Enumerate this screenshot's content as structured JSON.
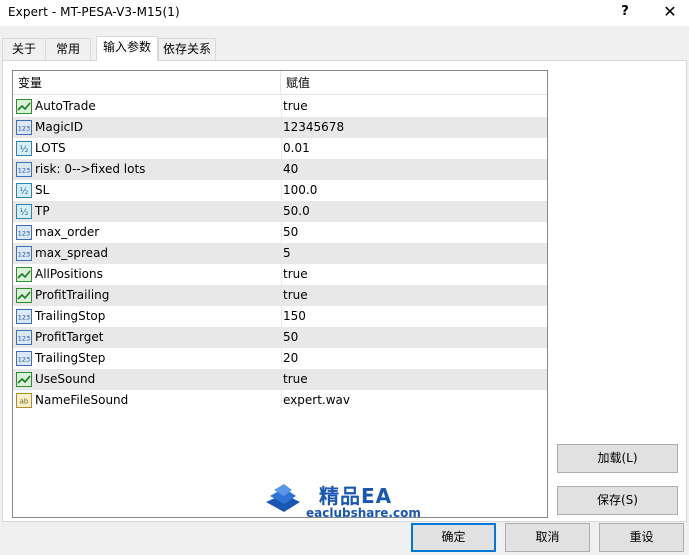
{
  "window": {
    "title": "Expert - MT-PESA-V3-M15(1)",
    "help_label": "?",
    "close_label": "✕"
  },
  "tabs": [
    {
      "label": "关于",
      "active": false
    },
    {
      "label": "常用",
      "active": false
    },
    {
      "label": "输入参数",
      "active": true
    },
    {
      "label": "依存关系",
      "active": false
    }
  ],
  "table": {
    "headers": {
      "name": "变量",
      "value": "赋值"
    },
    "rows": [
      {
        "name": "AutoTrade",
        "value": "true",
        "icon": "bool-icon"
      },
      {
        "name": "MagicID",
        "value": "12345678",
        "icon": "int-icon"
      },
      {
        "name": "LOTS",
        "value": "0.01",
        "icon": "double-icon"
      },
      {
        "name": "risk: 0-->fixed lots",
        "value": "40",
        "icon": "int-icon"
      },
      {
        "name": "SL",
        "value": "100.0",
        "icon": "double-icon"
      },
      {
        "name": "TP",
        "value": "50.0",
        "icon": "double-icon"
      },
      {
        "name": "max_order",
        "value": "50",
        "icon": "int-icon"
      },
      {
        "name": "max_spread",
        "value": "5",
        "icon": "int-icon"
      },
      {
        "name": "AllPositions",
        "value": "true",
        "icon": "bool-icon"
      },
      {
        "name": "ProfitTrailing",
        "value": "true",
        "icon": "bool-icon"
      },
      {
        "name": "TrailingStop",
        "value": "150",
        "icon": "int-icon"
      },
      {
        "name": "ProfitTarget",
        "value": "50",
        "icon": "int-icon"
      },
      {
        "name": "TrailingStep",
        "value": "20",
        "icon": "int-icon"
      },
      {
        "name": "UseSound",
        "value": "true",
        "icon": "bool-icon"
      },
      {
        "name": "NameFileSound",
        "value": "expert.wav",
        "icon": "string-icon"
      }
    ]
  },
  "icons": {
    "int_text": "123",
    "double_text": "½",
    "string_text": "ab"
  },
  "buttons": {
    "load": "加载(L)",
    "save": "保存(S)",
    "ok": "确定",
    "cancel": "取消",
    "reset": "重设"
  },
  "watermark": {
    "title": "精品EA",
    "url": "eaclubshare.com"
  },
  "colors": {
    "accent": "#0078d7",
    "watermark": "#1a56b4"
  }
}
